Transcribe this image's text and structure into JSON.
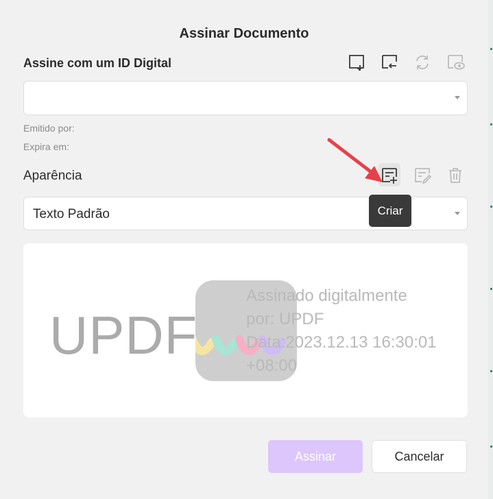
{
  "dialog": {
    "title": "Assinar Documento",
    "digital_id": {
      "label": "Assine com um ID Digital",
      "selected_value": "",
      "issued_by_label": "Emitido por:",
      "expires_label": "Expira em:"
    },
    "toolbar_icons": [
      "add-id-icon",
      "import-id-icon",
      "refresh-icon",
      "view-id-icon"
    ],
    "appearance": {
      "label": "Aparência",
      "selected_value": "Texto Padrão",
      "icons": [
        "create-appearance-icon",
        "edit-appearance-icon",
        "delete-icon"
      ],
      "tooltip": "Criar"
    },
    "preview": {
      "name": "UPDF",
      "lines": [
        "Assinado digitalmente",
        "por: UPDF",
        "Data:2023.12.13 16:30:01",
        "+08:00"
      ]
    },
    "buttons": {
      "sign": "Assinar",
      "cancel": "Cancelar"
    }
  },
  "colors": {
    "sign_button": "#dcc6fb",
    "arrow": "#e8404a",
    "tooltip_bg": "#3a3a3a"
  }
}
